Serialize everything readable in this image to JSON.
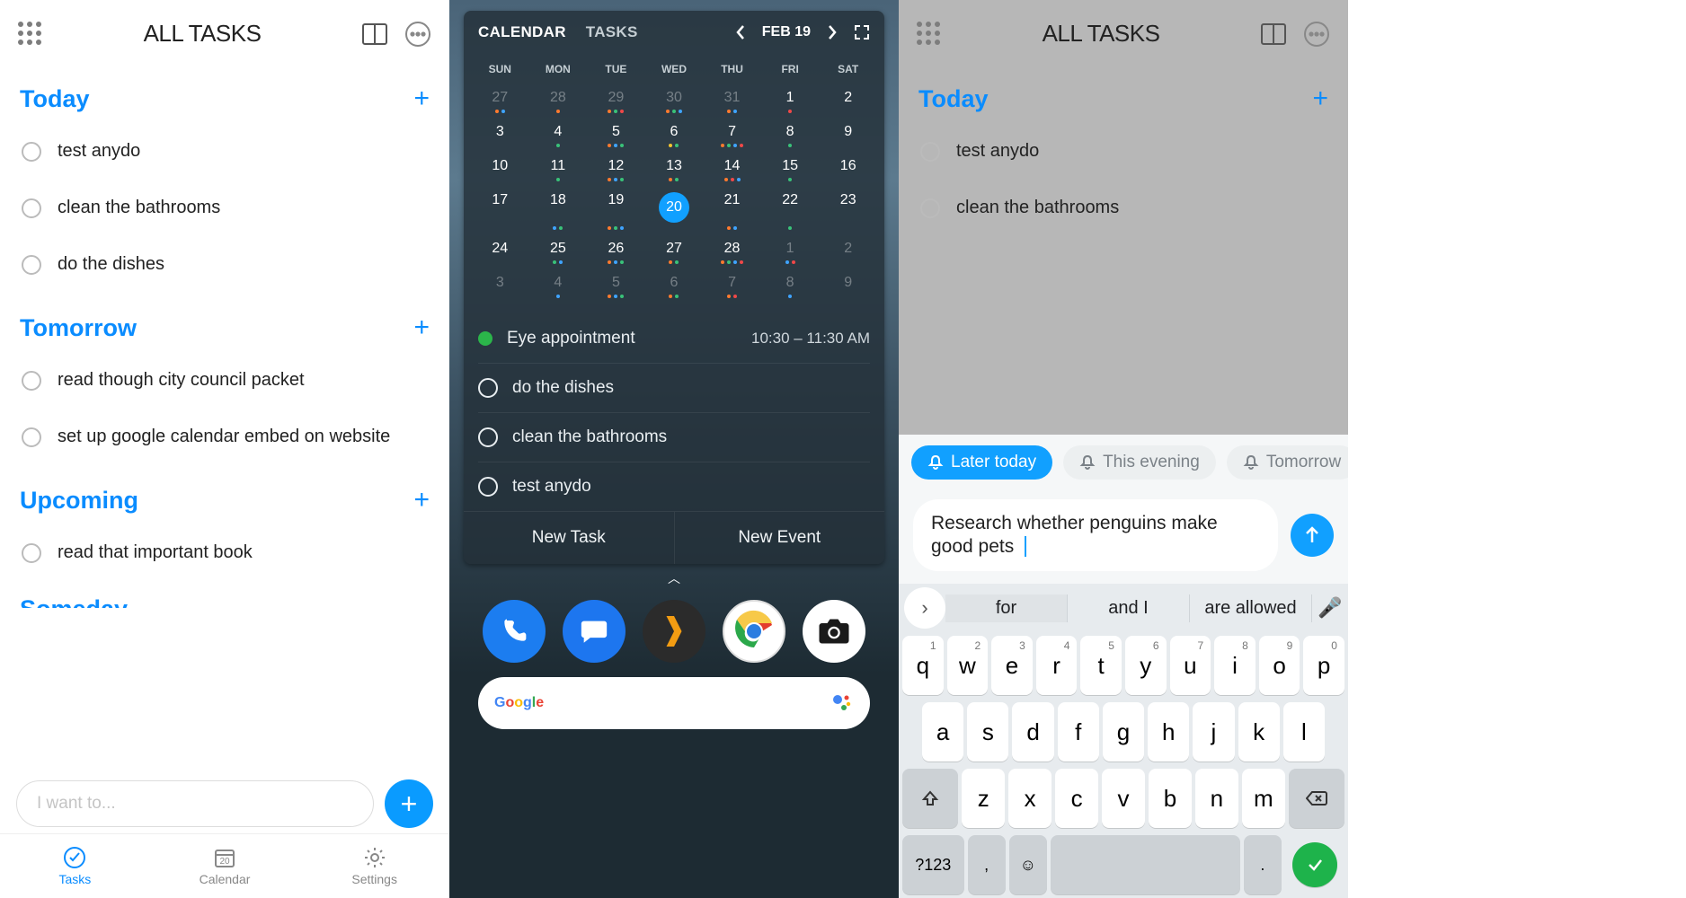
{
  "panel1": {
    "title": "ALL TASKS",
    "sections": [
      {
        "name": "Today",
        "tasks": [
          "test anydo",
          "clean the bathrooms",
          "do the dishes"
        ]
      },
      {
        "name": "Tomorrow",
        "tasks": [
          "read though city council packet",
          "set up google calendar embed on website"
        ]
      },
      {
        "name": "Upcoming",
        "tasks": [
          "read that important book"
        ]
      }
    ],
    "truncated_section": "Someday",
    "input_placeholder": "I want to...",
    "nav": {
      "tasks": "Tasks",
      "calendar": "Calendar",
      "calendar_day": "20",
      "settings": "Settings"
    }
  },
  "panel2": {
    "tabs": {
      "calendar": "CALENDAR",
      "tasks": "TASKS"
    },
    "date_label": "FEB 19",
    "day_headers": [
      "SUN",
      "MON",
      "TUE",
      "WED",
      "THU",
      "FRI",
      "SAT"
    ],
    "weeks": [
      [
        {
          "n": "27",
          "dim": true,
          "dots": [
            "o",
            "b"
          ]
        },
        {
          "n": "28",
          "dim": true,
          "dots": [
            "o"
          ]
        },
        {
          "n": "29",
          "dim": true,
          "dots": [
            "o",
            "g",
            "r"
          ]
        },
        {
          "n": "30",
          "dim": true,
          "dots": [
            "o",
            "g",
            "b"
          ]
        },
        {
          "n": "31",
          "dim": true,
          "dots": [
            "o",
            "b"
          ]
        },
        {
          "n": "1",
          "dots": [
            "r"
          ]
        },
        {
          "n": "2",
          "dots": []
        }
      ],
      [
        {
          "n": "3",
          "dots": []
        },
        {
          "n": "4",
          "dots": [
            "g"
          ]
        },
        {
          "n": "5",
          "dots": [
            "o",
            "b",
            "g"
          ]
        },
        {
          "n": "6",
          "dots": [
            "y",
            "g"
          ]
        },
        {
          "n": "7",
          "dots": [
            "o",
            "g",
            "b",
            "r"
          ]
        },
        {
          "n": "8",
          "dots": [
            "g"
          ]
        },
        {
          "n": "9",
          "dots": []
        }
      ],
      [
        {
          "n": "10",
          "dots": []
        },
        {
          "n": "11",
          "dots": [
            "g"
          ]
        },
        {
          "n": "12",
          "dots": [
            "o",
            "b",
            "g"
          ]
        },
        {
          "n": "13",
          "dots": [
            "o",
            "g"
          ]
        },
        {
          "n": "14",
          "dots": [
            "o",
            "r",
            "b"
          ]
        },
        {
          "n": "15",
          "dots": [
            "g"
          ]
        },
        {
          "n": "16",
          "dots": []
        }
      ],
      [
        {
          "n": "17",
          "dots": []
        },
        {
          "n": "18",
          "dots": [
            "b",
            "g"
          ]
        },
        {
          "n": "19",
          "dots": [
            "o",
            "g",
            "b"
          ]
        },
        {
          "n": "20",
          "sel": true,
          "dots": []
        },
        {
          "n": "21",
          "dots": [
            "o",
            "b"
          ]
        },
        {
          "n": "22",
          "dots": [
            "g"
          ]
        },
        {
          "n": "23",
          "dots": []
        }
      ],
      [
        {
          "n": "24",
          "dots": []
        },
        {
          "n": "25",
          "dots": [
            "g",
            "b"
          ]
        },
        {
          "n": "26",
          "dots": [
            "o",
            "b",
            "g"
          ]
        },
        {
          "n": "27",
          "dots": [
            "o",
            "g"
          ]
        },
        {
          "n": "28",
          "dots": [
            "o",
            "g",
            "b",
            "r"
          ]
        },
        {
          "n": "1",
          "dim": true,
          "dots": [
            "b",
            "r"
          ]
        },
        {
          "n": "2",
          "dim": true,
          "dots": []
        }
      ],
      [
        {
          "n": "3",
          "dim": true,
          "dots": []
        },
        {
          "n": "4",
          "dim": true,
          "dots": [
            "b"
          ]
        },
        {
          "n": "5",
          "dim": true,
          "dots": [
            "o",
            "b",
            "g"
          ]
        },
        {
          "n": "6",
          "dim": true,
          "dots": [
            "o",
            "g"
          ]
        },
        {
          "n": "7",
          "dim": true,
          "dots": [
            "o",
            "r"
          ]
        },
        {
          "n": "8",
          "dim": true,
          "dots": [
            "b"
          ]
        },
        {
          "n": "9",
          "dim": true,
          "dots": []
        }
      ]
    ],
    "event": {
      "title": "Eye appointment",
      "time": "10:30 – 11:30 AM"
    },
    "tasks": [
      "do the dishes",
      "clean the bathrooms",
      "test anydo"
    ],
    "actions": {
      "new_task": "New Task",
      "new_event": "New Event"
    }
  },
  "panel3": {
    "title": "ALL TASKS",
    "sections": [
      {
        "name": "Today",
        "tasks": [
          "test anydo",
          "clean the bathrooms"
        ]
      }
    ],
    "chips": [
      "Later today",
      "This evening",
      "Tomorrow"
    ],
    "compose_text": "Research whether penguins make good pets",
    "suggestions": [
      "for",
      "and I",
      "are allowed"
    ],
    "row1": [
      [
        "q",
        "1"
      ],
      [
        "w",
        "2"
      ],
      [
        "e",
        "3"
      ],
      [
        "r",
        "4"
      ],
      [
        "t",
        "5"
      ],
      [
        "y",
        "6"
      ],
      [
        "u",
        "7"
      ],
      [
        "i",
        "8"
      ],
      [
        "o",
        "9"
      ],
      [
        "p",
        "0"
      ]
    ],
    "row2": [
      "a",
      "s",
      "d",
      "f",
      "g",
      "h",
      "j",
      "k",
      "l"
    ],
    "row3": [
      "z",
      "x",
      "c",
      "v",
      "b",
      "n",
      "m"
    ],
    "fn": {
      "symbols": "?123",
      "comma": ",",
      "period": "."
    }
  }
}
